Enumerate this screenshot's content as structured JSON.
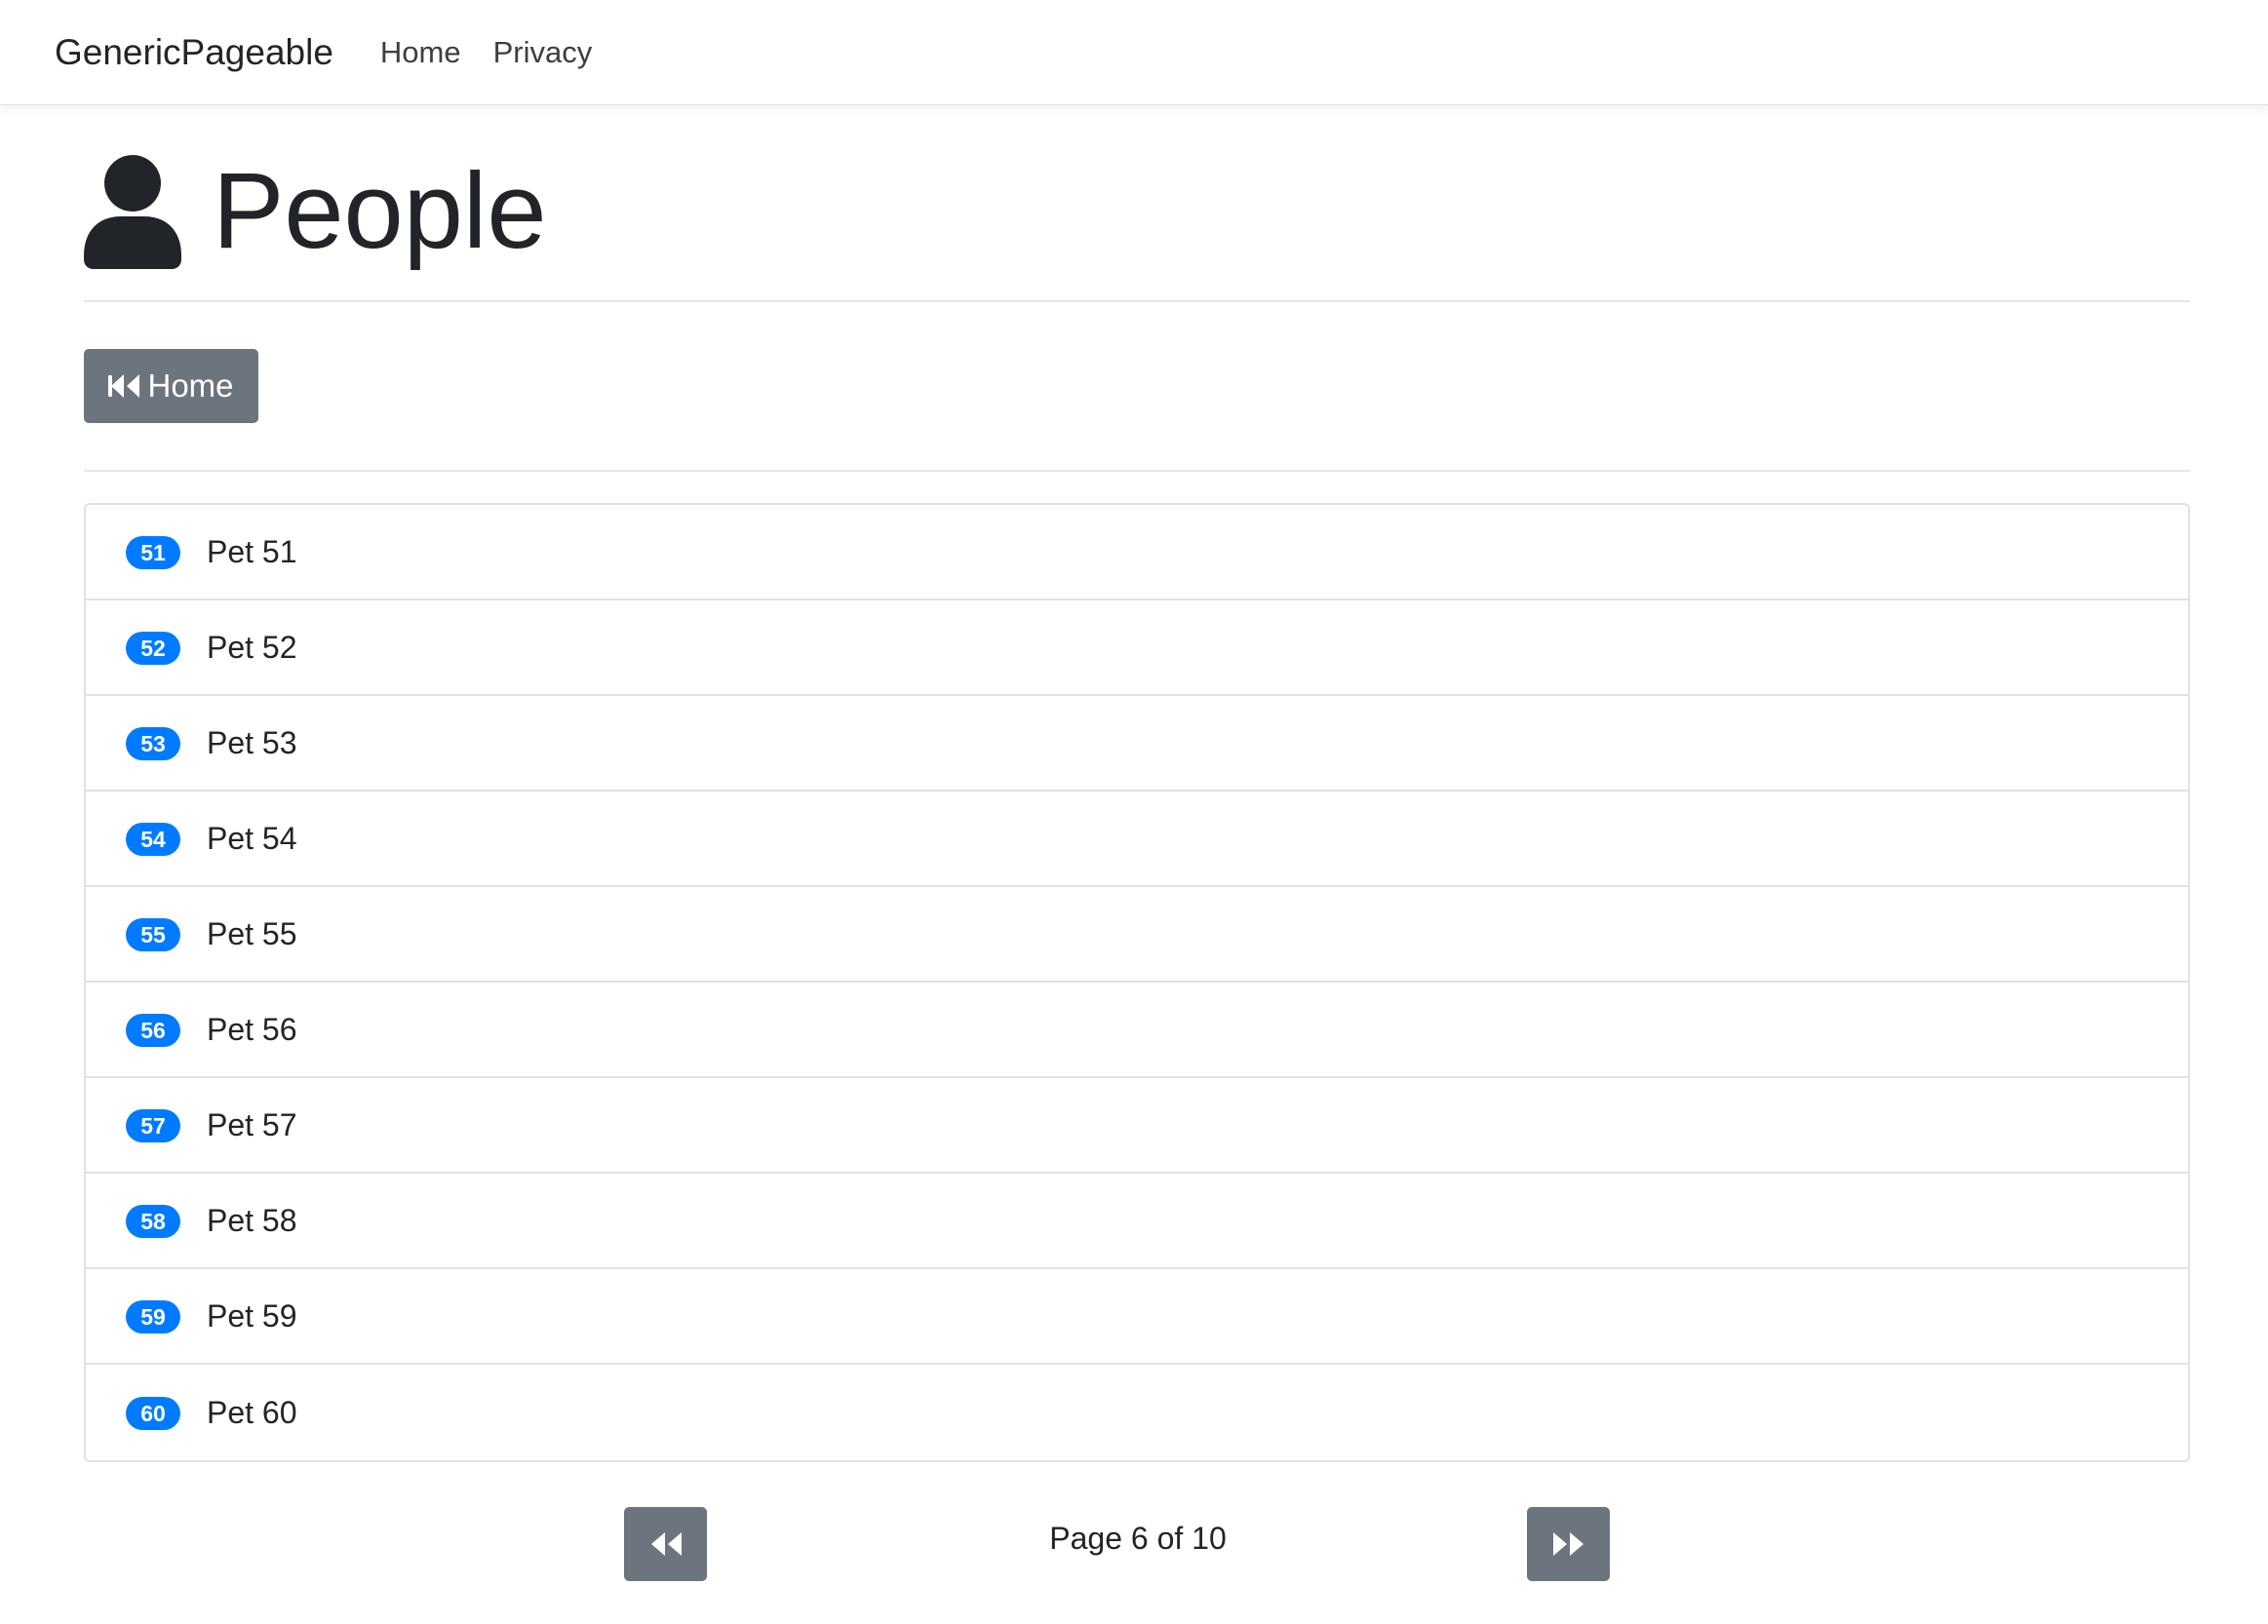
{
  "navbar": {
    "brand": "GenericPageable",
    "links": [
      {
        "label": "Home"
      },
      {
        "label": "Privacy"
      }
    ]
  },
  "header": {
    "icon": "user-icon",
    "title": "People"
  },
  "home_button": {
    "icon": "backward-icon",
    "label": "Home"
  },
  "items": [
    {
      "badge": "51",
      "label": "Pet 51"
    },
    {
      "badge": "52",
      "label": "Pet 52"
    },
    {
      "badge": "53",
      "label": "Pet 53"
    },
    {
      "badge": "54",
      "label": "Pet 54"
    },
    {
      "badge": "55",
      "label": "Pet 55"
    },
    {
      "badge": "56",
      "label": "Pet 56"
    },
    {
      "badge": "57",
      "label": "Pet 57"
    },
    {
      "badge": "58",
      "label": "Pet 58"
    },
    {
      "badge": "59",
      "label": "Pet 59"
    },
    {
      "badge": "60",
      "label": "Pet 60"
    }
  ],
  "pagination": {
    "prev_icon": "backward-icon",
    "next_icon": "forward-icon",
    "page_text": "Page 6 of 10",
    "current_page": 6,
    "total_pages": 10
  },
  "colors": {
    "badge": "#007bff",
    "button": "#6c757d",
    "text": "#212529"
  }
}
